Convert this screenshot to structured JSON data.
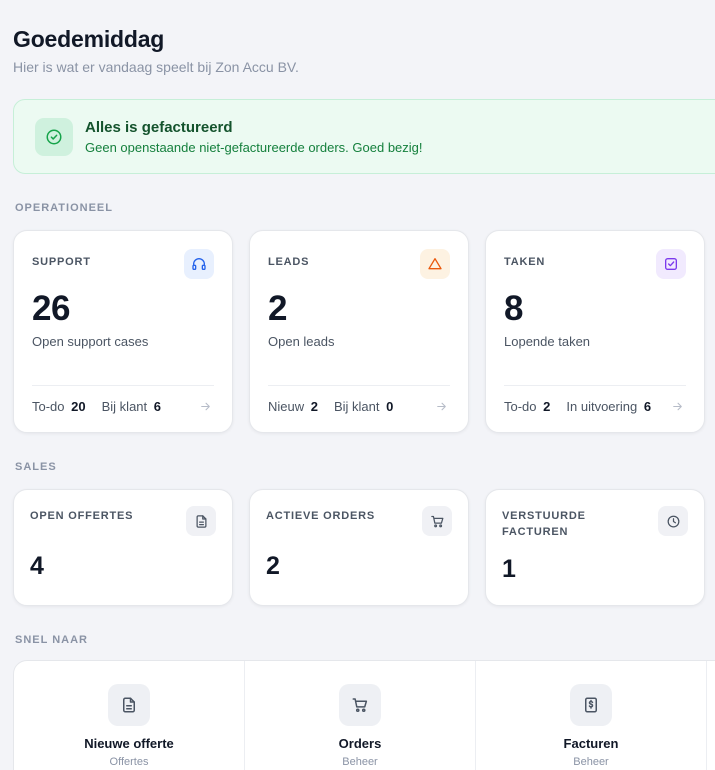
{
  "header": {
    "title": "Goedemiddag",
    "subtitle": "Hier is wat er vandaag speelt bij Zon Accu BV."
  },
  "banner": {
    "icon": "check-circle-icon",
    "title": "Alles is gefactureerd",
    "text": "Geen openstaande niet-gefactureerde orders. Goed bezig!",
    "accent": "#16a34a"
  },
  "sections": {
    "operational": "OPERATIONEEL",
    "sales": "SALES",
    "quick": "SNEL NAAR"
  },
  "operational_cards": [
    {
      "label": "SUPPORT",
      "icon": "headset-icon",
      "icon_color": "#2563eb",
      "value": "26",
      "caption": "Open support cases",
      "stats": [
        {
          "label": "To-do",
          "value": "20"
        },
        {
          "label": "Bij klant",
          "value": "6"
        }
      ]
    },
    {
      "label": "LEADS",
      "icon": "warning-triangle-icon",
      "icon_color": "#ea580c",
      "value": "2",
      "caption": "Open leads",
      "stats": [
        {
          "label": "Nieuw",
          "value": "2"
        },
        {
          "label": "Bij klant",
          "value": "0"
        }
      ]
    },
    {
      "label": "TAKEN",
      "icon": "checkbox-icon",
      "icon_color": "#7c3aed",
      "value": "8",
      "caption": "Lopende taken",
      "stats": [
        {
          "label": "To-do",
          "value": "2"
        },
        {
          "label": "In uitvoering",
          "value": "6"
        }
      ]
    }
  ],
  "sales_cards": [
    {
      "label": "OPEN OFFERTES",
      "icon": "document-icon",
      "value": "4"
    },
    {
      "label": "ACTIEVE ORDERS",
      "icon": "cart-icon",
      "value": "2"
    },
    {
      "label_line1": "VERSTUURDE",
      "label_line2": "FACTUREN",
      "icon": "clock-icon",
      "value": "1"
    }
  ],
  "quick_links": [
    {
      "title": "Nieuwe offerte",
      "subtitle": "Offertes",
      "icon": "document-icon"
    },
    {
      "title": "Orders",
      "subtitle": "Beheer",
      "icon": "cart-icon"
    },
    {
      "title": "Facturen",
      "subtitle": "Beheer",
      "icon": "invoice-icon"
    }
  ]
}
